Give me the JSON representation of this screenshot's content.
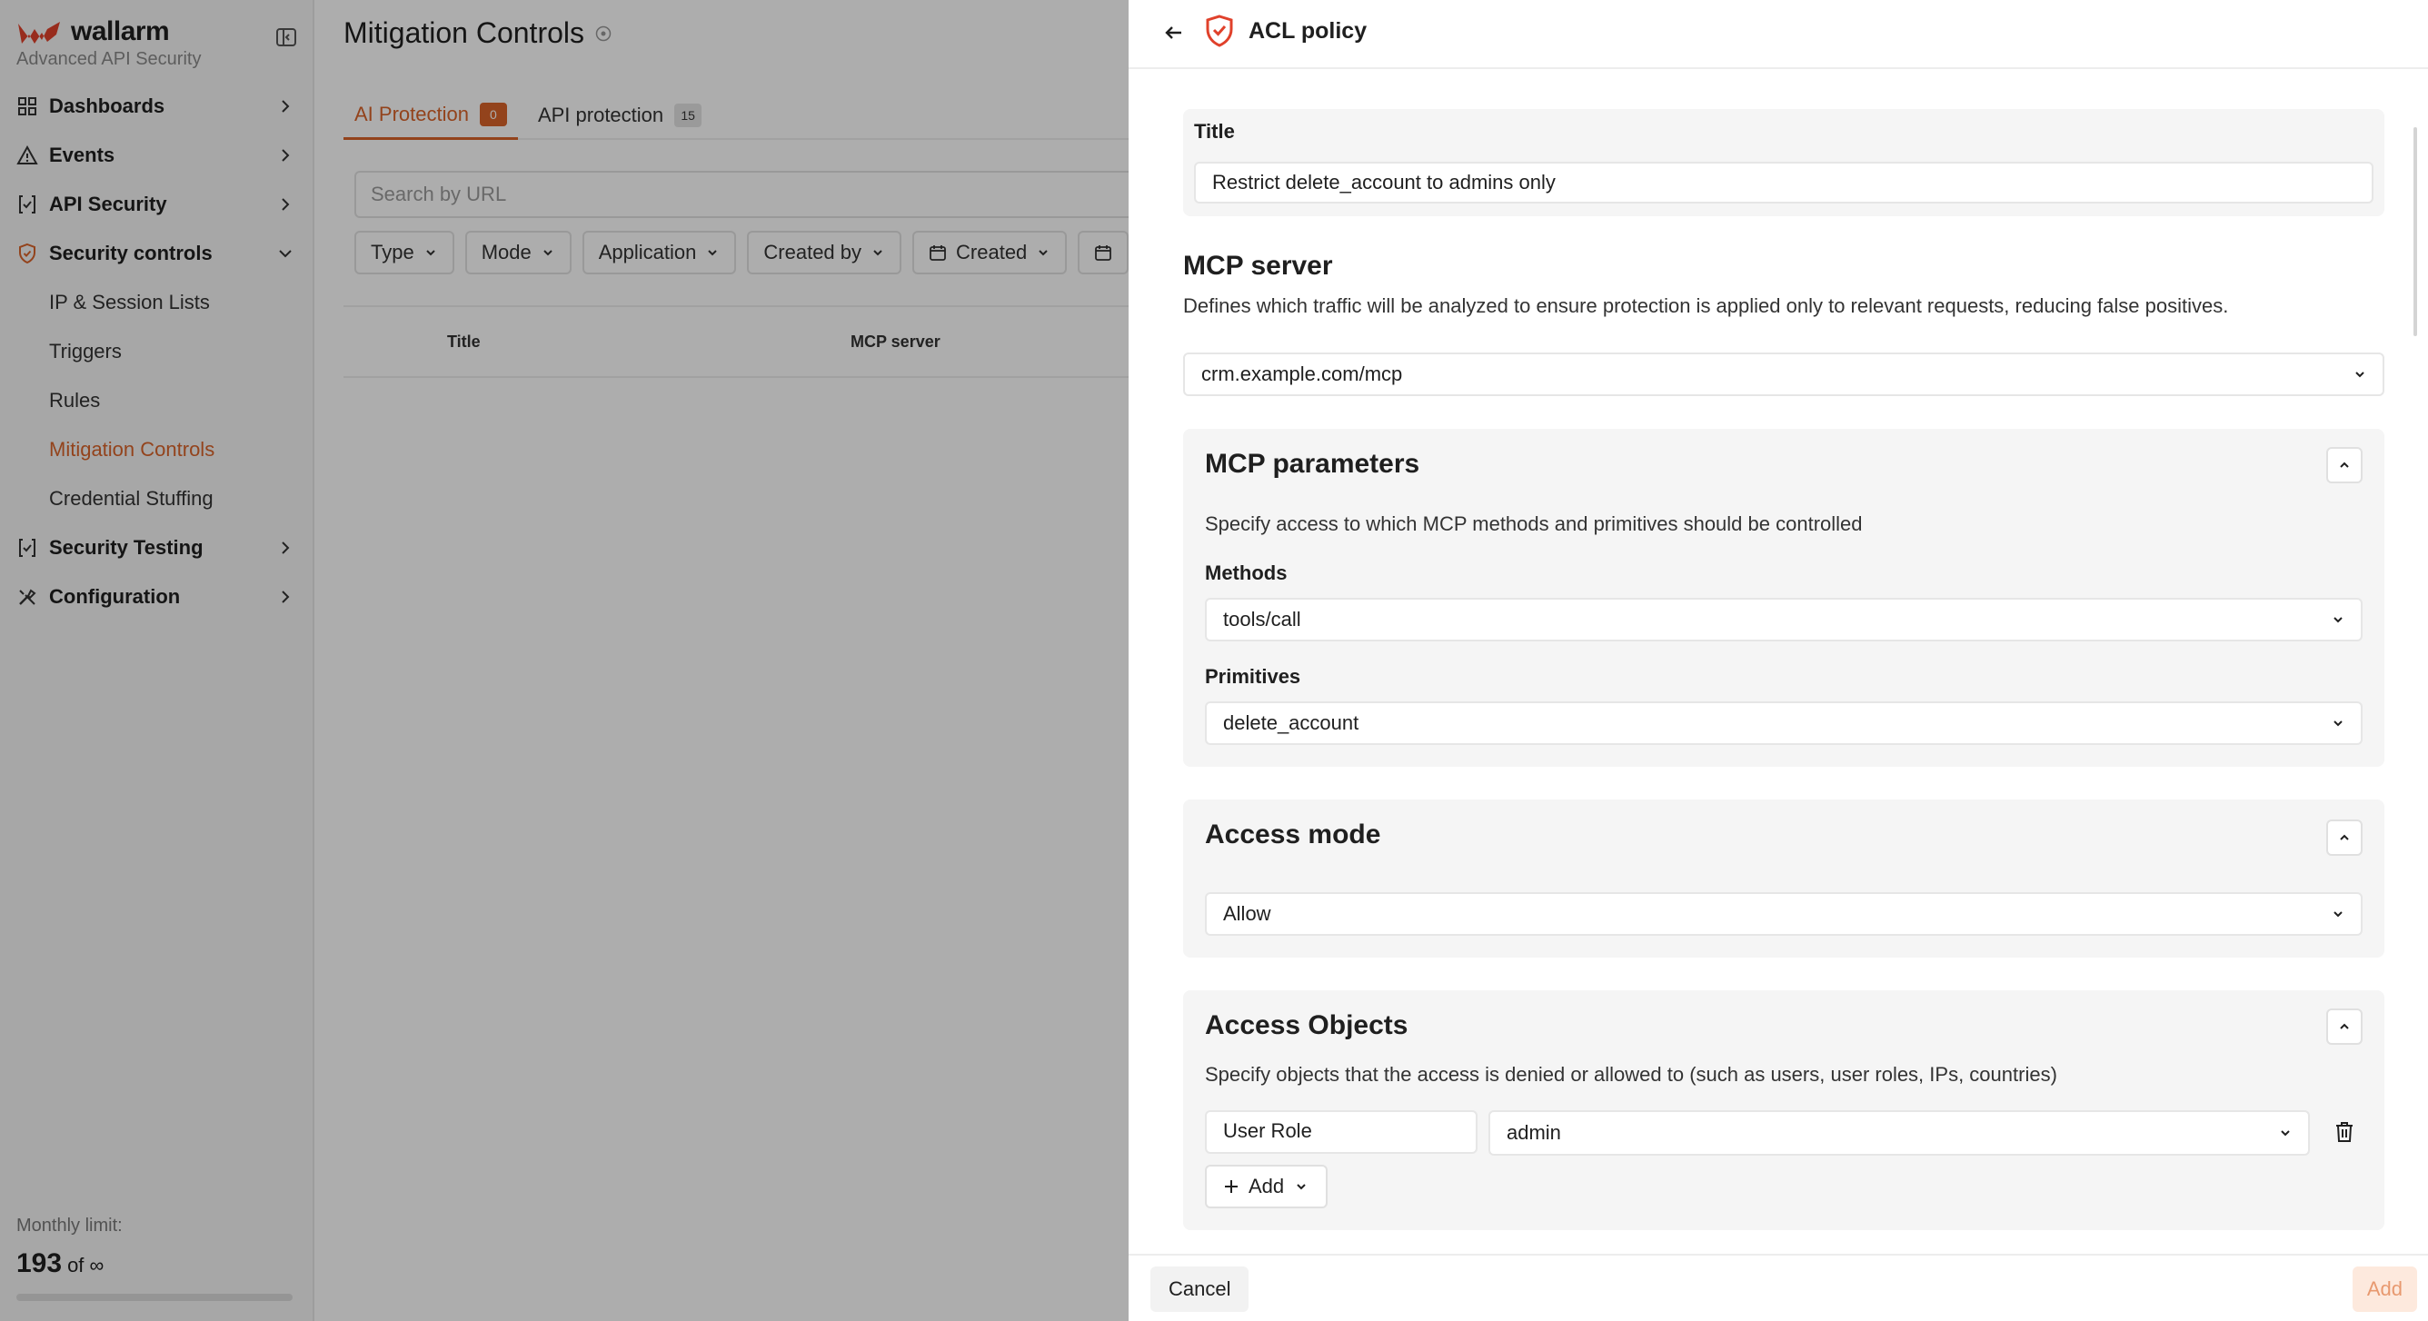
{
  "brand": {
    "name": "wallarm",
    "subtitle": "Advanced API Security"
  },
  "sidebar": {
    "items": [
      {
        "label": "Dashboards",
        "icon": "dashboard-icon"
      },
      {
        "label": "Events",
        "icon": "warning-icon"
      },
      {
        "label": "API Security",
        "icon": "api-icon"
      },
      {
        "label": "Security controls",
        "icon": "shield-icon",
        "expanded": true
      },
      {
        "label": "Security Testing",
        "icon": "api-icon"
      },
      {
        "label": "Configuration",
        "icon": "tools-icon"
      }
    ],
    "subitems": [
      "IP & Session Lists",
      "Triggers",
      "Rules",
      "Mitigation Controls",
      "Credential Stuffing"
    ],
    "active_subitem": "Mitigation Controls",
    "limit_label": "Monthly limit:",
    "limit_value": "193",
    "limit_of": "of ∞"
  },
  "main": {
    "title": "Mitigation Controls",
    "tabs": [
      {
        "label": "AI Protection",
        "count": "0",
        "active": true
      },
      {
        "label": "API protection",
        "count": "15",
        "active": false
      }
    ],
    "search_placeholder": "Search by URL",
    "filters": [
      "Type",
      "Mode",
      "Application",
      "Created by",
      "Created"
    ],
    "columns": [
      "Title",
      "MCP server"
    ]
  },
  "drawer": {
    "title": "ACL policy",
    "title_field": {
      "label": "Title",
      "value": "Restrict delete_account to admins only"
    },
    "mcp_server": {
      "heading": "MCP server",
      "description": "Defines which traffic will be analyzed to ensure protection is applied only to relevant requests, reducing false positives.",
      "value": "crm.example.com/mcp"
    },
    "mcp_parameters": {
      "heading": "MCP parameters",
      "description": "Specify access to which MCP methods and primitives should be controlled",
      "methods_label": "Methods",
      "methods_value": "tools/call",
      "primitives_label": "Primitives",
      "primitives_value": "delete_account"
    },
    "access_mode": {
      "heading": "Access mode",
      "value": "Allow"
    },
    "access_objects": {
      "heading": "Access Objects",
      "description": "Specify objects that the access is denied or allowed to (such as users, user roles, IPs, countries)",
      "object_type": "User Role",
      "object_value": "admin",
      "add_label": "Add"
    },
    "cancel_label": "Cancel",
    "submit_label": "Add"
  },
  "colors": {
    "accent": "#d9632a",
    "brand_red": "#e0412b"
  }
}
